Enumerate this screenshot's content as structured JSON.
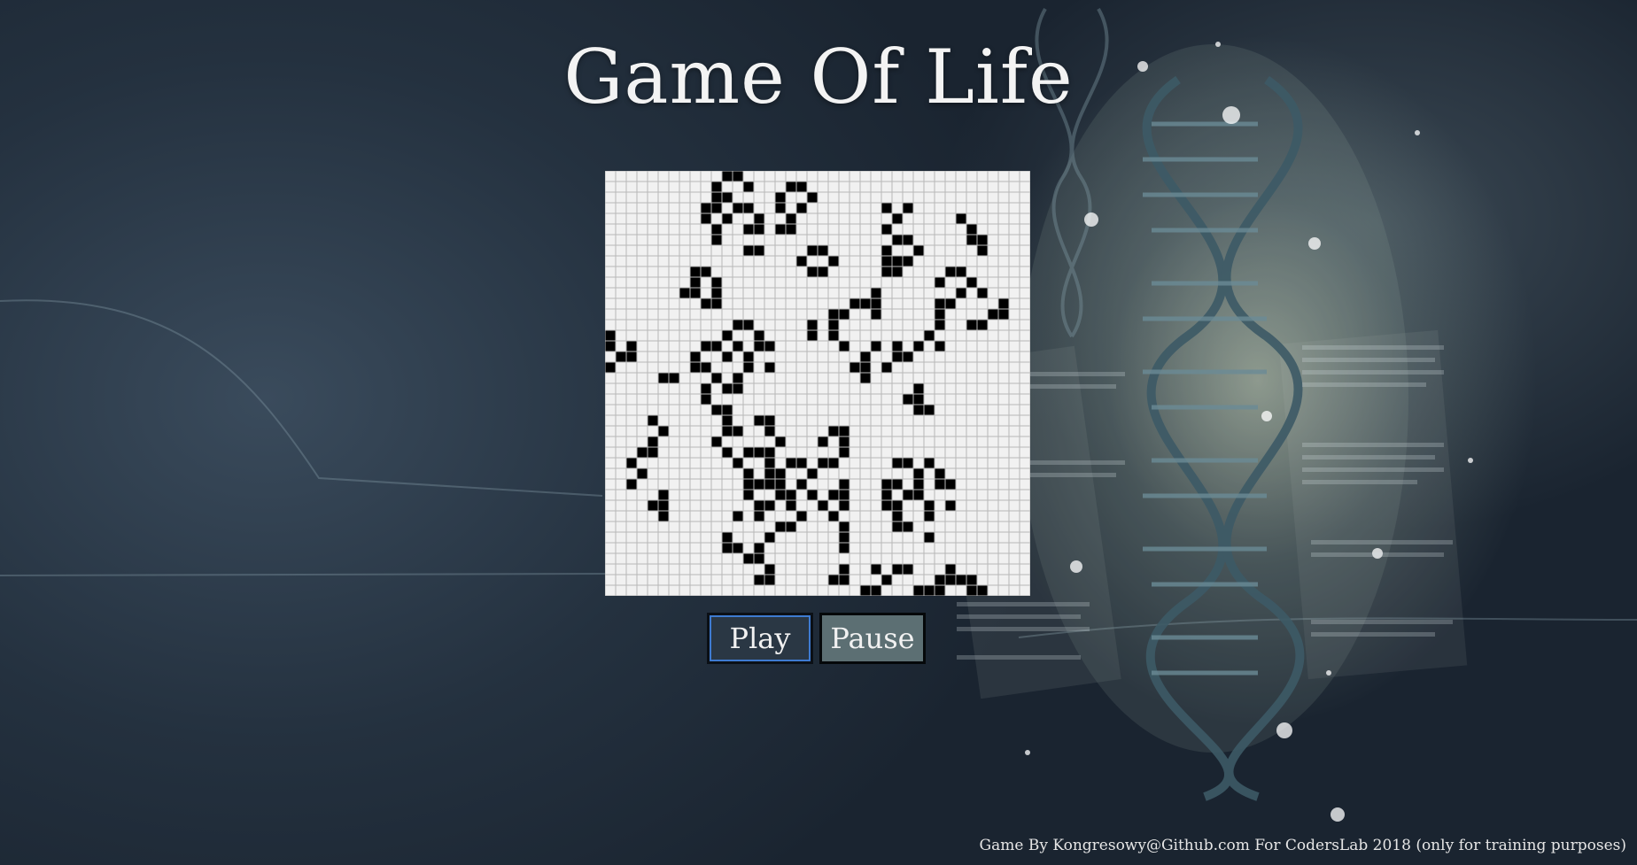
{
  "title": "Game Of Life",
  "grid": {
    "rows": 40,
    "cols": 40,
    "alive_color": "#000000",
    "dead_color": "#f1f1f1",
    "line_color": "#b8b8b8",
    "live_cells": [
      [
        0,
        11
      ],
      [
        0,
        12
      ],
      [
        1,
        10
      ],
      [
        1,
        13
      ],
      [
        1,
        17
      ],
      [
        1,
        18
      ],
      [
        2,
        10
      ],
      [
        2,
        11
      ],
      [
        2,
        16
      ],
      [
        2,
        19
      ],
      [
        3,
        9
      ],
      [
        3,
        10
      ],
      [
        3,
        12
      ],
      [
        3,
        13
      ],
      [
        3,
        16
      ],
      [
        3,
        18
      ],
      [
        3,
        26
      ],
      [
        3,
        28
      ],
      [
        4,
        9
      ],
      [
        4,
        11
      ],
      [
        4,
        14
      ],
      [
        4,
        17
      ],
      [
        4,
        27
      ],
      [
        4,
        33
      ],
      [
        5,
        10
      ],
      [
        5,
        13
      ],
      [
        5,
        14
      ],
      [
        5,
        16
      ],
      [
        5,
        17
      ],
      [
        5,
        26
      ],
      [
        5,
        34
      ],
      [
        6,
        10
      ],
      [
        6,
        27
      ],
      [
        6,
        28
      ],
      [
        6,
        34
      ],
      [
        6,
        35
      ],
      [
        7,
        13
      ],
      [
        7,
        14
      ],
      [
        7,
        19
      ],
      [
        7,
        20
      ],
      [
        7,
        26
      ],
      [
        7,
        29
      ],
      [
        7,
        35
      ],
      [
        8,
        18
      ],
      [
        8,
        21
      ],
      [
        8,
        26
      ],
      [
        8,
        27
      ],
      [
        8,
        28
      ],
      [
        9,
        8
      ],
      [
        9,
        9
      ],
      [
        9,
        19
      ],
      [
        9,
        20
      ],
      [
        9,
        26
      ],
      [
        9,
        27
      ],
      [
        9,
        32
      ],
      [
        9,
        33
      ],
      [
        10,
        8
      ],
      [
        10,
        10
      ],
      [
        10,
        31
      ],
      [
        10,
        34
      ],
      [
        11,
        7
      ],
      [
        11,
        8
      ],
      [
        11,
        10
      ],
      [
        11,
        25
      ],
      [
        11,
        33
      ],
      [
        11,
        35
      ],
      [
        12,
        9
      ],
      [
        12,
        10
      ],
      [
        12,
        23
      ],
      [
        12,
        24
      ],
      [
        12,
        25
      ],
      [
        12,
        31
      ],
      [
        12,
        32
      ],
      [
        12,
        37
      ],
      [
        13,
        21
      ],
      [
        13,
        22
      ],
      [
        13,
        25
      ],
      [
        13,
        31
      ],
      [
        13,
        36
      ],
      [
        13,
        37
      ],
      [
        14,
        12
      ],
      [
        14,
        13
      ],
      [
        14,
        19
      ],
      [
        14,
        21
      ],
      [
        14,
        31
      ],
      [
        14,
        34
      ],
      [
        14,
        35
      ],
      [
        15,
        0
      ],
      [
        15,
        11
      ],
      [
        15,
        14
      ],
      [
        15,
        19
      ],
      [
        15,
        21
      ],
      [
        15,
        30
      ],
      [
        16,
        0
      ],
      [
        16,
        2
      ],
      [
        16,
        9
      ],
      [
        16,
        10
      ],
      [
        16,
        12
      ],
      [
        16,
        14
      ],
      [
        16,
        15
      ],
      [
        16,
        22
      ],
      [
        16,
        25
      ],
      [
        16,
        27
      ],
      [
        16,
        29
      ],
      [
        16,
        31
      ],
      [
        17,
        1
      ],
      [
        17,
        2
      ],
      [
        17,
        8
      ],
      [
        17,
        11
      ],
      [
        17,
        13
      ],
      [
        17,
        24
      ],
      [
        17,
        27
      ],
      [
        17,
        28
      ],
      [
        18,
        0
      ],
      [
        18,
        8
      ],
      [
        18,
        9
      ],
      [
        18,
        13
      ],
      [
        18,
        15
      ],
      [
        18,
        23
      ],
      [
        18,
        24
      ],
      [
        18,
        26
      ],
      [
        19,
        5
      ],
      [
        19,
        6
      ],
      [
        19,
        10
      ],
      [
        19,
        12
      ],
      [
        19,
        24
      ],
      [
        20,
        9
      ],
      [
        20,
        11
      ],
      [
        20,
        12
      ],
      [
        20,
        29
      ],
      [
        21,
        9
      ],
      [
        21,
        28
      ],
      [
        21,
        29
      ],
      [
        22,
        10
      ],
      [
        22,
        11
      ],
      [
        22,
        29
      ],
      [
        22,
        30
      ],
      [
        23,
        4
      ],
      [
        23,
        11
      ],
      [
        23,
        14
      ],
      [
        23,
        15
      ],
      [
        24,
        5
      ],
      [
        24,
        11
      ],
      [
        24,
        12
      ],
      [
        24,
        15
      ],
      [
        24,
        21
      ],
      [
        24,
        22
      ],
      [
        25,
        4
      ],
      [
        25,
        10
      ],
      [
        25,
        16
      ],
      [
        25,
        20
      ],
      [
        25,
        22
      ],
      [
        26,
        3
      ],
      [
        26,
        4
      ],
      [
        26,
        11
      ],
      [
        26,
        13
      ],
      [
        26,
        14
      ],
      [
        26,
        15
      ],
      [
        26,
        22
      ],
      [
        27,
        2
      ],
      [
        27,
        12
      ],
      [
        27,
        15
      ],
      [
        27,
        17
      ],
      [
        27,
        18
      ],
      [
        27,
        20
      ],
      [
        27,
        21
      ],
      [
        27,
        27
      ],
      [
        27,
        28
      ],
      [
        27,
        30
      ],
      [
        28,
        3
      ],
      [
        28,
        13
      ],
      [
        28,
        15
      ],
      [
        28,
        16
      ],
      [
        28,
        19
      ],
      [
        28,
        29
      ],
      [
        28,
        31
      ],
      [
        29,
        2
      ],
      [
        29,
        13
      ],
      [
        29,
        14
      ],
      [
        29,
        15
      ],
      [
        29,
        16
      ],
      [
        29,
        18
      ],
      [
        29,
        22
      ],
      [
        29,
        26
      ],
      [
        29,
        27
      ],
      [
        29,
        29
      ],
      [
        29,
        31
      ],
      [
        29,
        32
      ],
      [
        30,
        5
      ],
      [
        30,
        13
      ],
      [
        30,
        16
      ],
      [
        30,
        17
      ],
      [
        30,
        19
      ],
      [
        30,
        21
      ],
      [
        30,
        22
      ],
      [
        30,
        26
      ],
      [
        30,
        28
      ],
      [
        30,
        29
      ],
      [
        31,
        4
      ],
      [
        31,
        5
      ],
      [
        31,
        14
      ],
      [
        31,
        15
      ],
      [
        31,
        17
      ],
      [
        31,
        20
      ],
      [
        31,
        22
      ],
      [
        31,
        26
      ],
      [
        31,
        27
      ],
      [
        31,
        30
      ],
      [
        31,
        32
      ],
      [
        32,
        5
      ],
      [
        32,
        12
      ],
      [
        32,
        14
      ],
      [
        32,
        18
      ],
      [
        32,
        21
      ],
      [
        32,
        27
      ],
      [
        32,
        30
      ],
      [
        33,
        16
      ],
      [
        33,
        17
      ],
      [
        33,
        22
      ],
      [
        33,
        27
      ],
      [
        33,
        28
      ],
      [
        34,
        11
      ],
      [
        34,
        15
      ],
      [
        34,
        22
      ],
      [
        34,
        30
      ],
      [
        35,
        11
      ],
      [
        35,
        12
      ],
      [
        35,
        14
      ],
      [
        35,
        22
      ],
      [
        36,
        13
      ],
      [
        36,
        14
      ],
      [
        37,
        15
      ],
      [
        37,
        22
      ],
      [
        37,
        25
      ],
      [
        37,
        27
      ],
      [
        37,
        28
      ],
      [
        37,
        32
      ],
      [
        38,
        14
      ],
      [
        38,
        15
      ],
      [
        38,
        21
      ],
      [
        38,
        22
      ],
      [
        38,
        26
      ],
      [
        38,
        31
      ],
      [
        38,
        32
      ],
      [
        38,
        33
      ],
      [
        38,
        34
      ],
      [
        39,
        24
      ],
      [
        39,
        25
      ],
      [
        39,
        29
      ],
      [
        39,
        30
      ],
      [
        39,
        31
      ],
      [
        39,
        34
      ],
      [
        39,
        35
      ]
    ]
  },
  "controls": {
    "play_label": "Play",
    "pause_label": "Pause",
    "play_border_color": "#3e7bd1"
  },
  "footer": "Game By Kongresowy@Github.com For CodersLab 2018 (only for training purposes)"
}
